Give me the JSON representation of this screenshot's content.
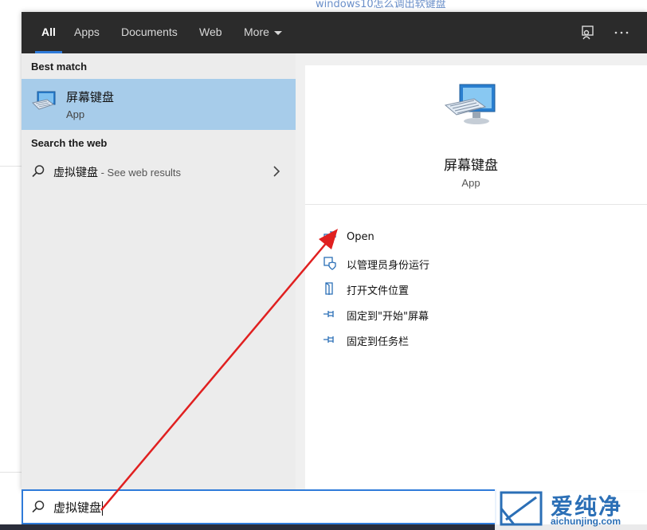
{
  "background": {
    "link_text": "windows10怎么调出软键盘"
  },
  "tabs": [
    {
      "label": "All",
      "active": true
    },
    {
      "label": "Apps",
      "active": false
    },
    {
      "label": "Documents",
      "active": false
    },
    {
      "label": "Web",
      "active": false
    },
    {
      "label": "More",
      "active": false
    }
  ],
  "top_icons": [
    "feedback-icon",
    "more-options-icon"
  ],
  "left": {
    "best_match_heading": "Best match",
    "best_match": {
      "title": "屏幕键盘",
      "subtitle": "App",
      "icon": "on-screen-keyboard-icon"
    },
    "web_heading": "Search the web",
    "web_result": {
      "query": "虚拟键盘",
      "suffix": " - See web results"
    }
  },
  "right": {
    "app_title": "屏幕键盘",
    "app_subtitle": "App",
    "actions": [
      {
        "label": "Open",
        "icon": "open-icon"
      },
      {
        "label": "以管理员身份运行",
        "icon": "run-as-admin-icon"
      },
      {
        "label": "打开文件位置",
        "icon": "file-location-icon"
      },
      {
        "label": "固定到\"开始\"屏幕",
        "icon": "pin-icon"
      },
      {
        "label": "固定到任务栏",
        "icon": "pin-icon"
      }
    ]
  },
  "searchbox": {
    "value": "虚拟键盘"
  },
  "watermark": {
    "text": "爱纯净",
    "url": "aichunjing.com"
  },
  "colors": {
    "accent": "#2f7bd9",
    "selection": "#a7ccea",
    "tabbar": "#2b2b2b",
    "annotation_arrow": "#e02020"
  }
}
